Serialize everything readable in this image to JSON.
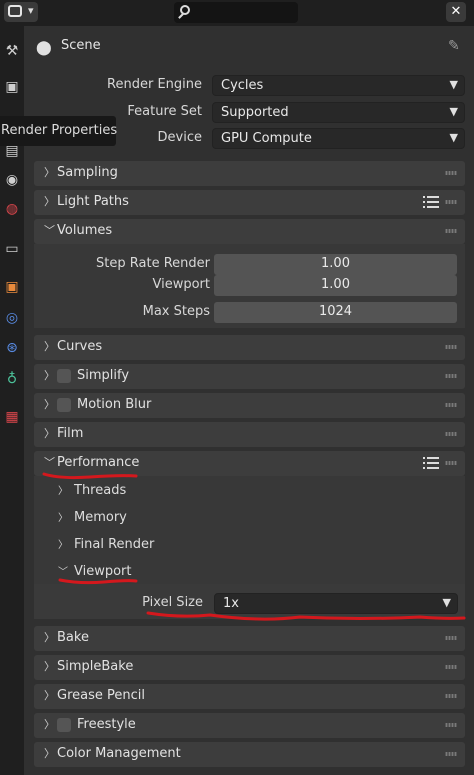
{
  "header": {
    "title": "Scene"
  },
  "tooltip": {
    "text": "Render Properties"
  },
  "render": {
    "engine_label": "Render Engine",
    "engine_value": "Cycles",
    "feature_label": "Feature Set",
    "feature_value": "Supported",
    "device_label": "Device",
    "device_value": "GPU Compute"
  },
  "panels": {
    "sampling": "Sampling",
    "light_paths": "Light Paths",
    "volumes": "Volumes",
    "curves": "Curves",
    "simplify": "Simplify",
    "motion_blur": "Motion Blur",
    "film": "Film",
    "performance": "Performance",
    "bake": "Bake",
    "simplebake": "SimpleBake",
    "grease_pencil": "Grease Pencil",
    "freestyle": "Freestyle",
    "color_management": "Color Management"
  },
  "volumes": {
    "step_rate_label": "Step Rate Render",
    "step_rate_value": "1.00",
    "viewport_label": "Viewport",
    "viewport_value": "1.00",
    "max_steps_label": "Max Steps",
    "max_steps_value": "1024"
  },
  "performance": {
    "threads": "Threads",
    "memory": "Memory",
    "final_render": "Final Render",
    "viewport": "Viewport",
    "pixel_size_label": "Pixel Size",
    "pixel_size_value": "1x"
  },
  "colors": {
    "annotation_red": "#d4181d",
    "panel_bg": "#3d3d3d"
  }
}
